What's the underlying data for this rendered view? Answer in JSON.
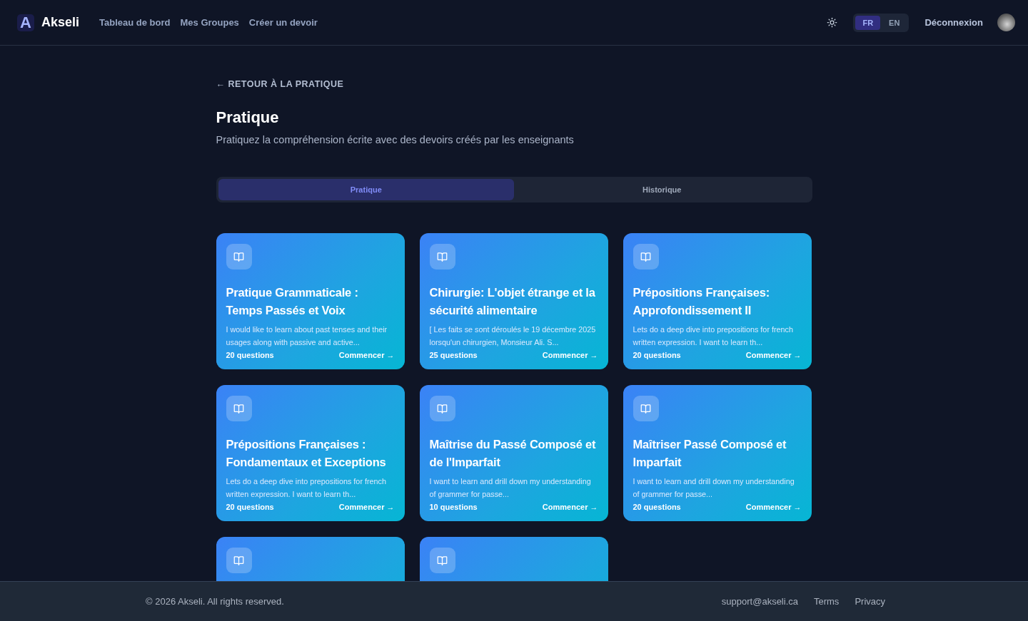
{
  "header": {
    "logo_letter": "A",
    "brand": "Akseli",
    "nav": [
      {
        "label": "Tableau de bord"
      },
      {
        "label": "Mes Groupes"
      },
      {
        "label": "Créer un devoir"
      }
    ],
    "languages": [
      {
        "label": "FR",
        "selected": true
      },
      {
        "label": "EN",
        "selected": false
      }
    ],
    "logout": "Déconnexion"
  },
  "back_link": "← RETOUR À LA PRATIQUE",
  "title": "Pratique",
  "subtitle": "Pratiquez la compréhension écrite avec des devoirs créés par les enseignants",
  "tabs": [
    {
      "label": "Pratique",
      "selected": true
    },
    {
      "label": "Historique",
      "selected": false
    }
  ],
  "cards": [
    {
      "kind": "full",
      "title": "Pratique Grammaticale : Temps Passés et Voix",
      "description": "I would like to learn about past tenses and their usages along with passive and active...",
      "count": "20 questions",
      "action": "Commencer →"
    },
    {
      "kind": "full",
      "title": "Chirurgie: L'objet étrange et la sécurité alimentaire",
      "description": "[ Les faits se sont déroulés le 19 décembre 2025 lorsqu'un chirurgien, Monsieur Ali. S...",
      "count": "25 questions",
      "action": "Commencer →"
    },
    {
      "kind": "full",
      "title": "Prépositions Françaises: Approfondissement II",
      "description": "Lets do a deep dive into prepositions for french written expression. I want to learn th...",
      "count": "20 questions",
      "action": "Commencer →"
    },
    {
      "kind": "full",
      "title": "Prépositions Françaises : Fondamentaux et Exceptions",
      "description": "Lets do a deep dive into prepositions for french written expression. I want to learn th...",
      "count": "20 questions",
      "action": "Commencer →"
    },
    {
      "kind": "full",
      "title": "Maîtrise du Passé Composé et de l'Imparfait",
      "description": "I want to learn and drill down my understanding of grammer for passe...",
      "count": "10 questions",
      "action": "Commencer →"
    },
    {
      "kind": "full",
      "title": "Maîtriser Passé Composé et Imparfait",
      "description": "I want to learn and drill down my understanding of grammer for passe...",
      "count": "20 questions",
      "action": "Commencer →"
    },
    {
      "kind": "partial"
    },
    {
      "kind": "partial"
    }
  ],
  "footer": {
    "copyright": "© 2026 Akseli. All rights reserved.",
    "links": [
      {
        "label": "support@akseli.ca"
      },
      {
        "label": "Terms"
      },
      {
        "label": "Privacy"
      }
    ]
  }
}
